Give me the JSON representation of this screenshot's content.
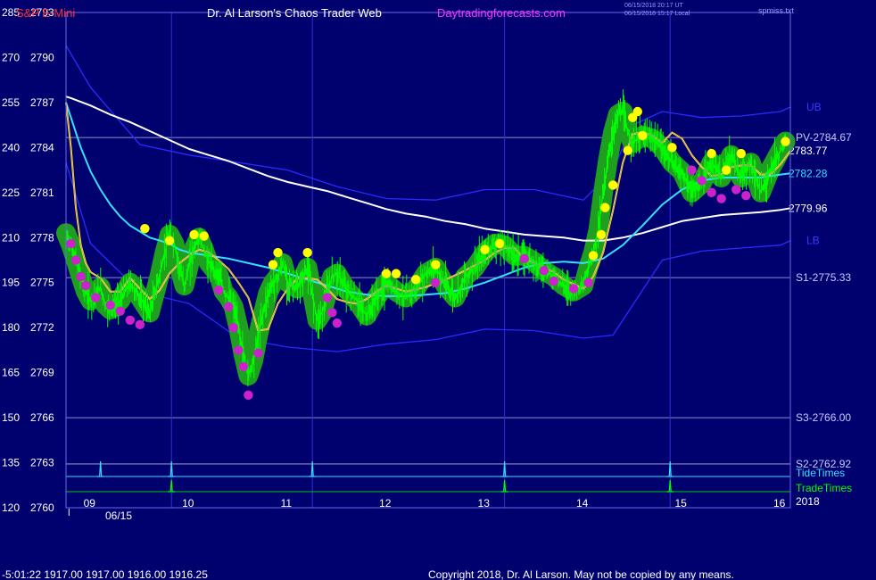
{
  "header": {
    "symbol": "S&P E-Mini",
    "title": "Dr. Al Larson's Chaos Trader Web",
    "site": "Daytradingforecasts.com",
    "timestamp_utc": "06/15/2018 20:17 UT",
    "timestamp_local": "06/15/2018 15:17 Local",
    "file": "spmiss.txt"
  },
  "colors": {
    "background": "#00006e",
    "price_bars": "#00ff00",
    "halo": "#1ea01e",
    "yellow_line": "#ffff00",
    "cyan_line": "#33e0ff",
    "white_line": "#ffffff",
    "band_line": "#2a2aff",
    "magenta_dots": "#cc22cc",
    "yellow_dots": "#ffff00",
    "level_lines": "#8c8cc8"
  },
  "chart_data": {
    "type": "line",
    "title": "S&P E-Mini",
    "y_left_ticks": [
      "285",
      "270",
      "255",
      "240",
      "225",
      "210",
      "195",
      "180",
      "165",
      "150",
      "135",
      "120"
    ],
    "y_price_ticks": [
      "2793",
      "2790",
      "2787",
      "2784",
      "2781",
      "2778",
      "2775",
      "2772",
      "2769",
      "2766",
      "2763",
      "2760"
    ],
    "ylim": [
      2760,
      2793
    ],
    "xlim": [
      8.75,
      16.1
    ],
    "x_ticks": [
      {
        "x": 9,
        "label": "09"
      },
      {
        "x": 10,
        "label": "10"
      },
      {
        "x": 11,
        "label": "11"
      },
      {
        "x": 12,
        "label": "12"
      },
      {
        "x": 13,
        "label": "13"
      },
      {
        "x": 14,
        "label": "14"
      },
      {
        "x": 15,
        "label": "15"
      },
      {
        "x": 16,
        "label": "16"
      }
    ],
    "date_label": "06/15",
    "year_label": "2018",
    "levels": [
      {
        "label": "PV-2784.67",
        "value": 2784.67
      },
      {
        "label": "S1-2775.33",
        "value": 2775.33
      },
      {
        "label": "S3-2766.00",
        "value": 2766.0
      },
      {
        "label": "S2-2762.92",
        "value": 2762.92
      }
    ],
    "band_labels": [
      {
        "label": "UB",
        "value": 2786.7
      },
      {
        "label": "LB",
        "value": 2777.8
      }
    ],
    "right_values": [
      {
        "label": "2783.77",
        "value": 2783.77,
        "color": "#ffffff"
      },
      {
        "label": "2782.28",
        "value": 2782.28,
        "color": "#33e0ff"
      },
      {
        "label": "2779.96",
        "value": 2779.96,
        "color": "#ffffff"
      }
    ],
    "tide_label": "TideTimes",
    "trade_label": "TradeTimes",
    "tide_times": [
      9.1,
      9.82,
      11.25,
      13.2,
      14.88
    ],
    "trade_times": [
      9.82,
      13.2,
      14.88
    ],
    "vertical_markers": [
      9.82,
      11.25,
      13.2,
      14.88
    ],
    "series": [
      {
        "name": "price",
        "color": "#00ff00",
        "x": [
          8.75,
          8.8,
          8.85,
          8.9,
          8.95,
          9.0,
          9.05,
          9.1,
          9.15,
          9.2,
          9.3,
          9.4,
          9.5,
          9.6,
          9.7,
          9.75,
          9.8,
          9.85,
          9.9,
          9.95,
          10.0,
          10.05,
          10.1,
          10.15,
          10.2,
          10.3,
          10.35,
          10.4,
          10.45,
          10.5,
          10.55,
          10.6,
          10.65,
          10.7,
          10.75,
          10.8,
          10.85,
          10.9,
          10.95,
          11.0,
          11.1,
          11.2,
          11.3,
          11.35,
          11.4,
          11.45,
          11.5,
          11.6,
          11.7,
          11.8,
          11.9,
          12.0,
          12.1,
          12.2,
          12.3,
          12.4,
          12.5,
          12.6,
          12.7,
          12.8,
          12.9,
          13.0,
          13.1,
          13.2,
          13.3,
          13.4,
          13.5,
          13.6,
          13.7,
          13.8,
          13.9,
          14.0,
          14.05,
          14.1,
          14.15,
          14.2,
          14.25,
          14.3,
          14.35,
          14.4,
          14.45,
          14.5,
          14.6,
          14.7,
          14.8,
          14.9,
          15.0,
          15.1,
          15.2,
          15.3,
          15.4,
          15.5,
          15.6,
          15.7,
          15.8,
          15.9,
          16.0,
          16.05
        ],
        "y": [
          2778.3,
          2777.5,
          2776.5,
          2775.4,
          2774.4,
          2773.8,
          2774.2,
          2774.7,
          2773.5,
          2773.2,
          2773.8,
          2775.0,
          2774.0,
          2773.0,
          2775.5,
          2777.0,
          2778.2,
          2777.6,
          2776.0,
          2774.8,
          2776.2,
          2777.3,
          2778.0,
          2777.2,
          2776.3,
          2775.5,
          2774.4,
          2774.0,
          2773.4,
          2772.0,
          2770.2,
          2768.8,
          2769.8,
          2771.5,
          2773.0,
          2774.3,
          2775.0,
          2775.4,
          2776.3,
          2775.0,
          2774.6,
          2776.0,
          2772.5,
          2773.0,
          2774.3,
          2775.4,
          2775.6,
          2774.5,
          2773.8,
          2772.8,
          2774.0,
          2775.0,
          2774.4,
          2774.0,
          2774.6,
          2775.6,
          2776.0,
          2774.8,
          2774.0,
          2775.4,
          2776.0,
          2777.0,
          2777.6,
          2777.5,
          2776.8,
          2776.8,
          2776.4,
          2775.8,
          2775.4,
          2774.8,
          2774.4,
          2774.8,
          2776.0,
          2777.0,
          2778.5,
          2781.0,
          2783.2,
          2785.0,
          2786.2,
          2786.4,
          2785.0,
          2784.3,
          2784.8,
          2784.6,
          2784.0,
          2783.0,
          2782.4,
          2781.0,
          2781.6,
          2783.0,
          2782.0,
          2783.5,
          2782.0,
          2783.0,
          2781.0,
          2782.6,
          2783.8,
          2784.4
        ]
      },
      {
        "name": "yellow",
        "color": "#ffff00",
        "x": [
          8.75,
          8.8,
          8.85,
          8.9,
          8.95,
          9.0,
          9.1,
          9.2,
          9.3,
          9.4,
          9.5,
          9.6,
          9.7,
          9.8,
          9.9,
          10.0,
          10.1,
          10.2,
          10.3,
          10.4,
          10.5,
          10.6,
          10.7,
          10.8,
          10.9,
          11.0,
          11.1,
          11.2,
          11.3,
          11.4,
          11.5,
          11.6,
          11.7,
          11.8,
          11.9,
          12.0,
          12.2,
          12.4,
          12.6,
          12.8,
          13.0,
          13.1,
          13.2,
          13.3,
          13.4,
          13.5,
          13.6,
          13.7,
          13.8,
          13.9,
          14.0,
          14.1,
          14.2,
          14.3,
          14.4,
          14.5,
          14.6,
          14.7,
          14.8,
          14.9,
          15.0,
          15.1,
          15.2,
          15.3,
          15.4,
          15.5,
          15.6,
          15.7,
          15.8,
          15.9,
          16.0,
          16.1
        ],
        "y": [
          2787.0,
          2784.0,
          2780.0,
          2777.5,
          2776.3,
          2775.7,
          2775.3,
          2774.4,
          2774.4,
          2775.3,
          2774.6,
          2773.9,
          2774.5,
          2775.6,
          2776.3,
          2776.8,
          2777.2,
          2777.0,
          2776.5,
          2775.9,
          2775.0,
          2774.0,
          2771.8,
          2771.9,
          2773.6,
          2774.6,
          2775.3,
          2775.3,
          2775.2,
          2774.6,
          2773.9,
          2773.7,
          2773.6,
          2773.9,
          2774.4,
          2774.8,
          2774.4,
          2774.7,
          2775.2,
          2775.8,
          2776.5,
          2777.0,
          2777.3,
          2777.3,
          2776.6,
          2776.3,
          2776.0,
          2775.7,
          2775.2,
          2774.9,
          2774.6,
          2775.4,
          2777.0,
          2779.8,
          2783.0,
          2784.9,
          2785.0,
          2784.8,
          2784.3,
          2785.0,
          2784.6,
          2783.5,
          2782.7,
          2782.1,
          2782.2,
          2782.7,
          2782.8,
          2782.8,
          2782.2,
          2782.2,
          2782.9,
          2783.77
        ]
      },
      {
        "name": "cyan",
        "color": "#33e0ff",
        "x": [
          8.75,
          8.8,
          8.9,
          9.0,
          9.1,
          9.2,
          9.3,
          9.4,
          9.5,
          9.6,
          9.7,
          9.8,
          9.9,
          10.0,
          10.2,
          10.4,
          10.6,
          10.8,
          11.0,
          11.2,
          11.4,
          11.6,
          11.8,
          12.0,
          12.2,
          12.4,
          12.6,
          12.8,
          13.0,
          13.2,
          13.4,
          13.6,
          13.8,
          14.0,
          14.2,
          14.4,
          14.6,
          14.8,
          15.0,
          15.2,
          15.4,
          15.6,
          15.8,
          16.0,
          16.1
        ],
        "y": [
          2787.0,
          2786.0,
          2784.0,
          2782.4,
          2781.2,
          2780.2,
          2779.4,
          2778.8,
          2778.4,
          2778.0,
          2777.8,
          2777.6,
          2777.2,
          2777.0,
          2776.8,
          2776.6,
          2776.3,
          2776.0,
          2775.6,
          2775.2,
          2774.8,
          2774.4,
          2774.2,
          2774.1,
          2774.1,
          2774.2,
          2774.3,
          2774.6,
          2775.0,
          2775.5,
          2776.0,
          2776.3,
          2776.4,
          2776.3,
          2776.6,
          2777.5,
          2778.8,
          2780.2,
          2781.2,
          2781.8,
          2782.0,
          2782.0,
          2782.0,
          2782.2,
          2782.28
        ]
      },
      {
        "name": "white",
        "color": "#ffffff",
        "x": [
          8.75,
          8.8,
          9.0,
          9.2,
          9.4,
          9.6,
          9.8,
          10.0,
          10.2,
          10.4,
          10.6,
          10.8,
          11.0,
          11.2,
          11.4,
          11.6,
          11.8,
          12.0,
          12.2,
          12.4,
          12.6,
          12.8,
          13.0,
          13.2,
          13.4,
          13.6,
          13.8,
          14.0,
          14.2,
          14.4,
          14.6,
          14.8,
          15.0,
          15.2,
          15.4,
          15.6,
          15.8,
          16.0,
          16.1
        ],
        "y": [
          2787.4,
          2787.3,
          2786.8,
          2786.2,
          2785.7,
          2785.1,
          2784.5,
          2783.9,
          2783.5,
          2783.1,
          2782.6,
          2782.1,
          2781.7,
          2781.4,
          2781.1,
          2780.7,
          2780.3,
          2779.9,
          2779.6,
          2779.4,
          2779.1,
          2778.9,
          2778.6,
          2778.4,
          2778.2,
          2778.1,
          2778.0,
          2777.8,
          2777.8,
          2778.0,
          2778.3,
          2778.7,
          2779.1,
          2779.3,
          2779.5,
          2779.6,
          2779.7,
          2779.85,
          2779.96
        ]
      },
      {
        "name": "band_top",
        "color": "#2a2aff",
        "x": [
          8.75,
          9.0,
          9.5,
          10.0,
          10.5,
          11.0,
          11.5,
          12.0,
          12.5,
          13.0,
          13.5,
          14.0,
          14.3,
          14.5,
          14.8,
          15.2,
          15.6,
          16.0,
          16.1
        ],
        "y": [
          2790.8,
          2788.0,
          2784.2,
          2783.5,
          2783.0,
          2782.5,
          2781.4,
          2780.6,
          2780.5,
          2781.2,
          2781.2,
          2780.5,
          2782.5,
          2785.5,
          2786.4,
          2786.0,
          2786.1,
          2786.4,
          2786.7
        ]
      },
      {
        "name": "band_bottom",
        "color": "#2a2aff",
        "x": [
          8.75,
          9.0,
          9.5,
          10.0,
          10.5,
          11.0,
          11.5,
          12.0,
          12.5,
          13.0,
          13.5,
          14.0,
          14.3,
          14.5,
          14.8,
          15.2,
          15.6,
          16.0,
          16.1
        ],
        "y": [
          2783.0,
          2777.6,
          2774.4,
          2773.6,
          2771.3,
          2770.7,
          2770.4,
          2770.9,
          2771.2,
          2771.9,
          2771.8,
          2771.3,
          2771.5,
          2773.5,
          2776.5,
          2777.1,
          2777.3,
          2777.5,
          2777.8
        ]
      }
    ],
    "dots": [
      {
        "color": "#ffff00",
        "x": [
          9.55,
          9.8,
          10.05,
          10.15,
          10.85,
          10.9,
          11.2,
          12.0,
          12.1,
          12.3,
          12.5,
          13.0,
          13.15,
          14.1,
          14.18,
          14.22,
          14.3,
          14.45,
          14.5,
          14.55,
          14.6,
          14.9,
          15.3,
          15.45,
          15.6,
          16.05
        ],
        "y": [
          2778.6,
          2777.8,
          2778.2,
          2778.1,
          2776.2,
          2777.0,
          2777.0,
          2775.6,
          2775.6,
          2775.2,
          2776.2,
          2777.2,
          2777.6,
          2776.8,
          2778.2,
          2780.0,
          2781.5,
          2783.8,
          2786.0,
          2786.4,
          2784.8,
          2784.0,
          2783.6,
          2782.5,
          2783.6,
          2784.4
        ]
      },
      {
        "color": "#cc22cc",
        "x": [
          8.8,
          8.85,
          8.9,
          8.95,
          9.05,
          9.2,
          9.3,
          9.4,
          9.5,
          10.3,
          10.4,
          10.45,
          10.5,
          10.55,
          10.6,
          10.7,
          11.4,
          11.45,
          11.5,
          12.5,
          13.4,
          13.6,
          13.7,
          13.9,
          14.05,
          15.1,
          15.2,
          15.3,
          15.4,
          15.55,
          15.65
        ],
        "y": [
          2777.6,
          2776.5,
          2775.4,
          2774.8,
          2774.0,
          2773.5,
          2773.1,
          2772.5,
          2772.2,
          2774.5,
          2773.4,
          2772.0,
          2770.5,
          2769.4,
          2767.5,
          2770.3,
          2774.0,
          2773.0,
          2772.3,
          2775.0,
          2776.6,
          2775.8,
          2775.1,
          2774.6,
          2775.0,
          2782.5,
          2781.8,
          2781.0,
          2780.6,
          2781.2,
          2780.8
        ]
      }
    ]
  },
  "footer": {
    "readout": "-5:01:22  1917.00 1917.00 1916.00 1916.25",
    "copyright": "Copyright 2018, Dr. Al Larson. May not be copied by any means."
  }
}
